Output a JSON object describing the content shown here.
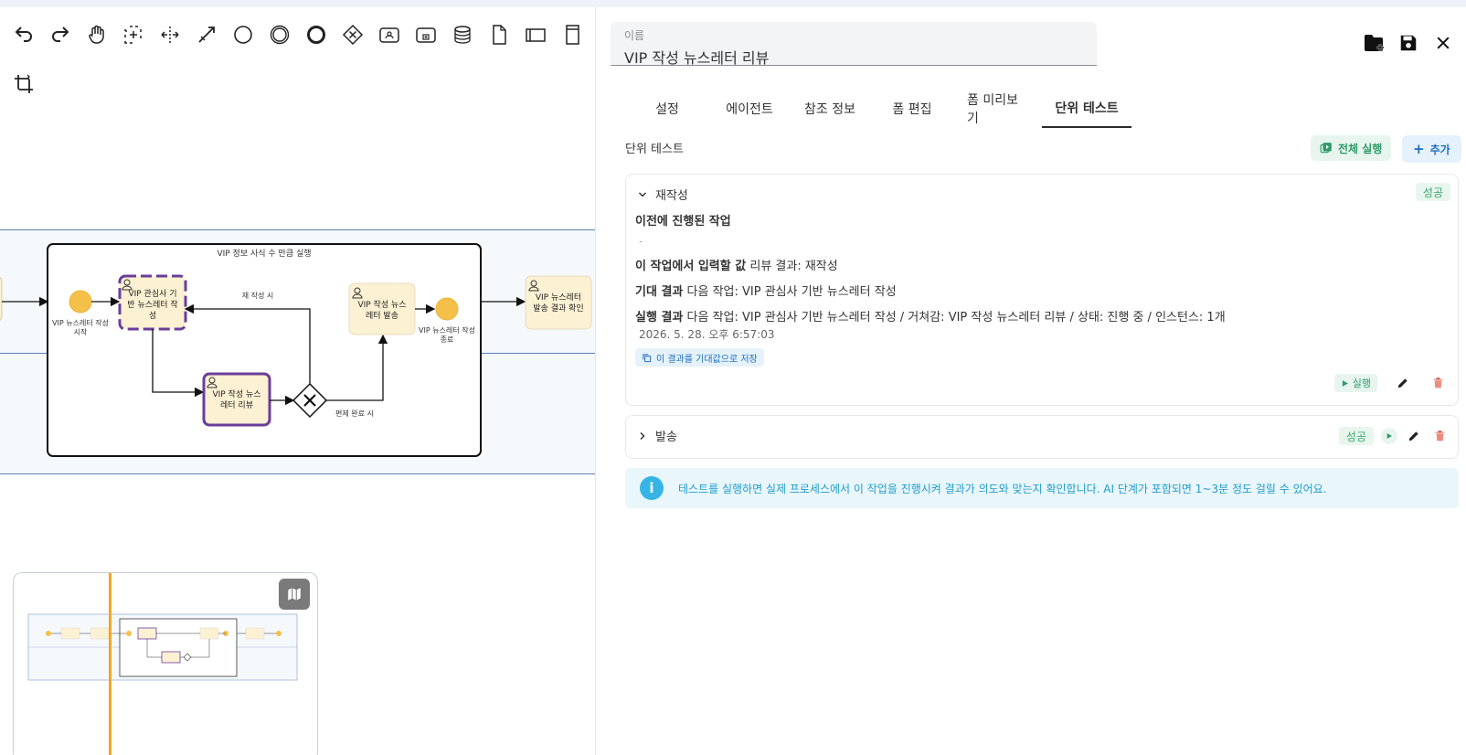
{
  "diagram": {
    "subprocess_title": "VIP 정보 사식 수 만큼 실행",
    "start_event_label": [
      "VIP 뉴스레터 작성",
      "시작"
    ],
    "end_event_label": [
      "VIP 뉴스레터 작성",
      "종료"
    ],
    "task_draft": [
      "VIP 관심사 기",
      "반 뉴스레터 작",
      "성"
    ],
    "task_review": [
      "VIP 작성 뉴스",
      "레터 리뷰"
    ],
    "task_send": [
      "VIP 작성 뉴스",
      "레터 발송"
    ],
    "task_confirm": [
      "VIP 뉴스레터",
      "발송 결과 확인"
    ],
    "flow_rewrite": "재 작성 시",
    "flow_approve": "편제 완료 시"
  },
  "panel": {
    "name_label": "이름",
    "name_value": "VIP 작성 뉴스레터 리뷰",
    "tabs": [
      "설정",
      "에이전트",
      "참조 정보",
      "폼 편집",
      "폼 미리보기",
      "단위 테스트"
    ],
    "active_tab": "단위 테스트",
    "section_title": "단위 테스트",
    "run_all_label": "전체 실행",
    "add_label": "추가"
  },
  "tests": [
    {
      "title": "재작성",
      "status": "성공",
      "prev_label": "이전에 진행된 작업",
      "prev_value": "-",
      "input_label": "이 작업에서 입력할 값",
      "input_value": "리뷰 결과: 재작성",
      "expected_label": "기대 결과",
      "expected_value": "다음 작업: VIP 관심사 기반 뉴스레터 작성",
      "actual_label": "실행 결과",
      "actual_value": "다음 작업: VIP 관심사 기반 뉴스레터 작성 / 거쳐감: VIP 작성 뉴스레터 리뷰 / 상태: 진행 중 / 인스턴스: 1개",
      "timestamp": "2026. 5. 28. 오후 6:57:03",
      "save_label": "이 결과를 기대값으로 저장",
      "run_label": "실행"
    },
    {
      "title": "발송",
      "status": "성공"
    }
  ],
  "info_text": "테스트를 실행하면 실제 프로세스에서 이 작업을 진행시켜 결과가 의도와 맞는지 확인합니다. AI 단계가 포함되면 1~3분 정도 걸릴 수 있어요.",
  "colors": {
    "accent": "#1e6fc0",
    "success": "#3aa36b",
    "info": "#35b5e3",
    "task_fill": "#fdf1d3",
    "event_fill": "#f5c04a",
    "selected_stroke": "#6a3d9a"
  }
}
